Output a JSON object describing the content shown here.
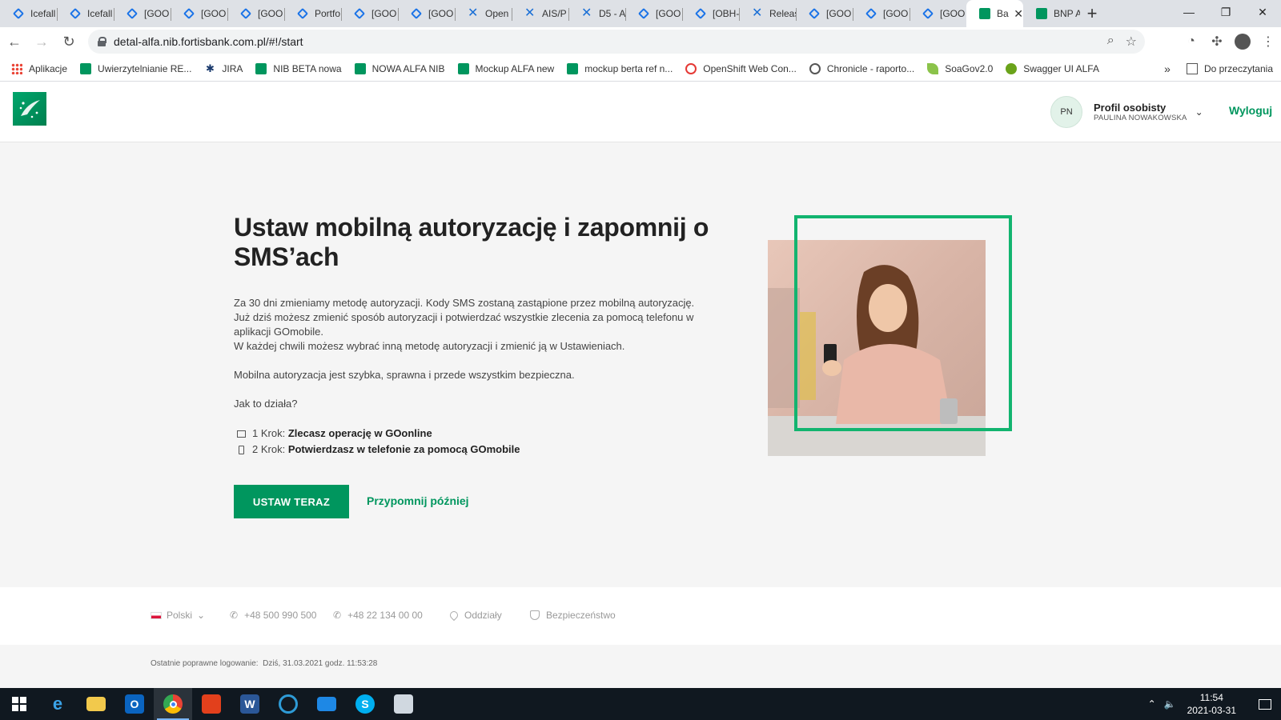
{
  "browser": {
    "tabs": [
      {
        "label": "Icefall",
        "icon": "diamond"
      },
      {
        "label": "Icefall",
        "icon": "diamond"
      },
      {
        "label": "[GOO",
        "icon": "diamond"
      },
      {
        "label": "[GOO",
        "icon": "diamond"
      },
      {
        "label": "[GOO",
        "icon": "diamond"
      },
      {
        "label": "Portfo",
        "icon": "diamond"
      },
      {
        "label": "[GOO",
        "icon": "diamond"
      },
      {
        "label": "[GOO",
        "icon": "diamond"
      },
      {
        "label": "Open",
        "icon": "confluence"
      },
      {
        "label": "AIS/P",
        "icon": "confluence"
      },
      {
        "label": "D5 - A",
        "icon": "confluence"
      },
      {
        "label": "[GOO",
        "icon": "diamond"
      },
      {
        "label": "[OBH-",
        "icon": "diamond"
      },
      {
        "label": "Releas",
        "icon": "confluence"
      },
      {
        "label": "[GOO",
        "icon": "diamond"
      },
      {
        "label": "[GOO",
        "icon": "diamond"
      },
      {
        "label": "[GOO",
        "icon": "diamond"
      },
      {
        "label": "Ba",
        "icon": "bnp",
        "active": true
      },
      {
        "label": "BNP A",
        "icon": "bnp"
      }
    ],
    "url": "detal-alfa.nib.fortisbank.com.pl/#!/start",
    "bookmarks": [
      {
        "label": "Aplikacje",
        "icon": "grid"
      },
      {
        "label": "Uwierzytelnianie RE...",
        "icon": "green"
      },
      {
        "label": "JIRA",
        "icon": "jira"
      },
      {
        "label": "NIB BETA nowa",
        "icon": "green"
      },
      {
        "label": "NOWA ALFA NIB",
        "icon": "green"
      },
      {
        "label": "Mockup ALFA new",
        "icon": "green"
      },
      {
        "label": "mockup berta ref n...",
        "icon": "green"
      },
      {
        "label": "OpenShift Web Con...",
        "icon": "red"
      },
      {
        "label": "Chronicle - raporto...",
        "icon": "gray"
      },
      {
        "label": "SoaGov2.0",
        "icon": "leaf"
      },
      {
        "label": "Swagger UI ALFA",
        "icon": "sw"
      }
    ],
    "bookmarks_more": "»",
    "reading_list": "Do przeczytania"
  },
  "header": {
    "avatar_initials": "PN",
    "profile_title": "Profil osobisty",
    "profile_name": "PAULINA NOWAKOWSKA",
    "logout": "Wyloguj"
  },
  "main": {
    "title": "Ustaw mobilną autoryzację i zapomnij o SMS’ach",
    "para1": "Za 30 dni zmieniamy metodę autoryzacji. Kody SMS zostaną zastąpione przez mobilną autoryzację. Już dziś możesz zmienić sposób autoryzacji i potwierdzać wszystkie zlecenia za pomocą telefonu w aplikacji GOmobile.",
    "para1b": "W każdej chwili możesz wybrać inną metodę autoryzacji i zmienić ją w Ustawieniach.",
    "para2": "Mobilna autoryzacja jest szybka, sprawna i przede wszystkim bezpieczna.",
    "para3": "Jak to działa?",
    "step1_prefix": "1 Krok: ",
    "step1_text": "Zlecasz operację w GOonline",
    "step2_prefix": "2 Krok: ",
    "step2_text": "Potwierdzasz w telefonie za pomocą GOmobile",
    "primary_button": "USTAW TERAZ",
    "secondary_link": "Przypomnij później"
  },
  "footer": {
    "language": "Polski",
    "phone1": "+48 500 990 500",
    "phone2": "+48 22 134 00 00",
    "branches": "Oddziały",
    "security": "Bezpieczeństwo",
    "last_login_label": "Ostatnie poprawne logowanie:",
    "last_login_value": "Dziś, 31.03.2021 godz. 11:53:28"
  },
  "taskbar": {
    "time": "11:54",
    "date": "2021-03-31"
  }
}
